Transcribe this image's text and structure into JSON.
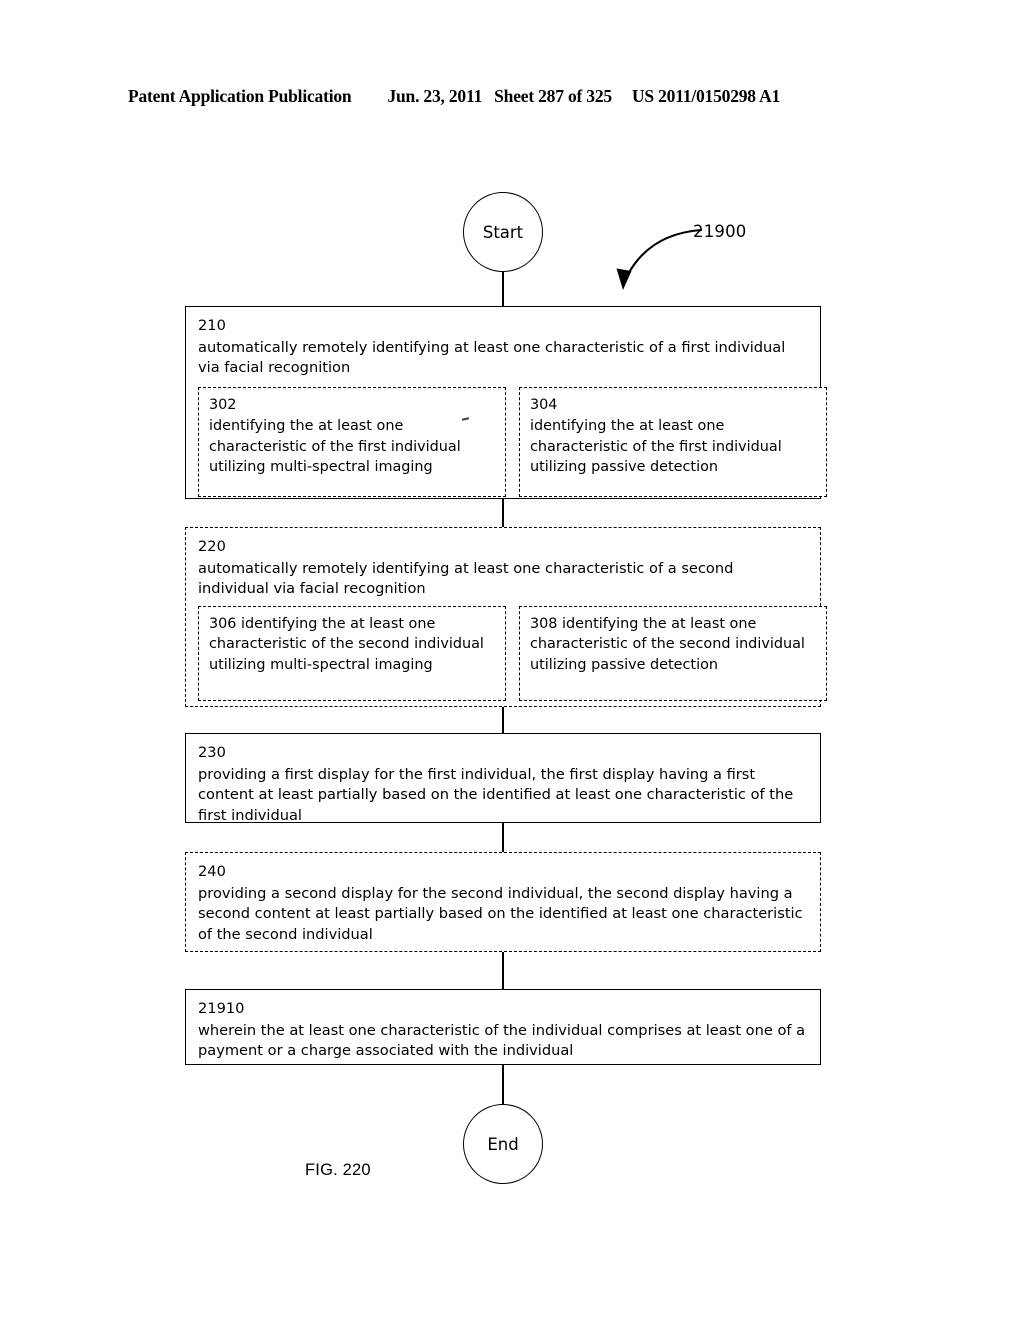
{
  "header": {
    "title": "Patent Application Publication",
    "date": "Jun. 23, 2011",
    "sheet": "Sheet 287 of 325",
    "patent_number": "US 2011/0150298 A1"
  },
  "figure": {
    "caption": "FIG. 220",
    "callout_label": "21900",
    "callout_arrow_icon": "curved-arrow-icon"
  },
  "flow": {
    "start_label": "Start",
    "end_label": "End",
    "steps": [
      {
        "num": "210",
        "text": "automatically remotely identifying at least one characteristic of a first individual via facial recognition",
        "border": "solid",
        "substeps": [
          {
            "num": "302",
            "num_inline": false,
            "text": "identifying the at least one characteristic of the first individual utilizing multi-spectral imaging"
          },
          {
            "num": "304",
            "num_inline": false,
            "text": "identifying the at least one characteristic of the first individual utilizing passive detection"
          }
        ]
      },
      {
        "num": "220",
        "text": "automatically remotely identifying at least one characteristic of a second individual via facial recognition",
        "border": "dashed",
        "substeps": [
          {
            "num": "306",
            "num_inline": true,
            "text": "identifying the at least one characteristic of the second individual utilizing multi-spectral imaging"
          },
          {
            "num": "308",
            "num_inline": true,
            "text": "identifying the at least one characteristic of the second individual utilizing passive detection"
          }
        ]
      },
      {
        "num": "230",
        "text": "providing a first display for the first individual, the first display having a first content at least partially based on the identified at least one characteristic of the first individual",
        "border": "solid",
        "substeps": []
      },
      {
        "num": "240",
        "text": "providing a second display for the second individual, the second display having a second content at least partially based on the identified at least one characteristic of the second individual",
        "border": "dashed",
        "substeps": []
      },
      {
        "num": "21910",
        "text": "wherein the at least one characteristic of the individual comprises at least one of a payment or a charge associated with the individual",
        "border": "solid",
        "substeps": []
      }
    ]
  }
}
